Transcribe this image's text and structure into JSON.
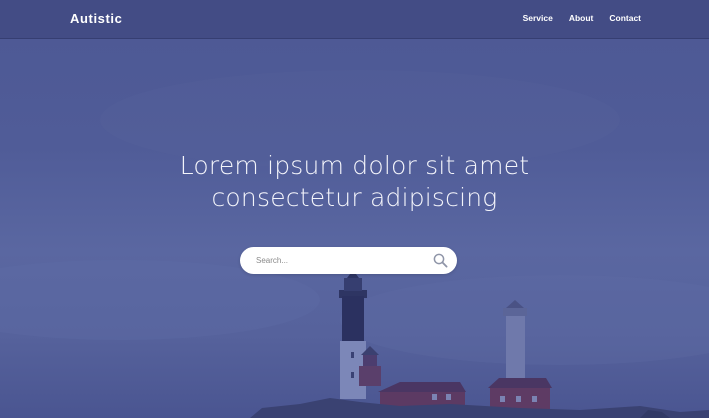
{
  "brand": {
    "name": "Autistic"
  },
  "nav": {
    "links": [
      {
        "label": "Service"
      },
      {
        "label": "About"
      },
      {
        "label": "Contact"
      }
    ]
  },
  "hero": {
    "headline_line1": "Lorem ipsum dolor sit amet",
    "headline_line2": "consectetur adipiscing"
  },
  "search": {
    "placeholder": "Search..."
  },
  "icons": {
    "search": "magnifier-icon"
  },
  "colors": {
    "overlay": "#4b5793",
    "navbar": "#404880",
    "text": "#ffffff",
    "search_bg": "#ffffff"
  }
}
